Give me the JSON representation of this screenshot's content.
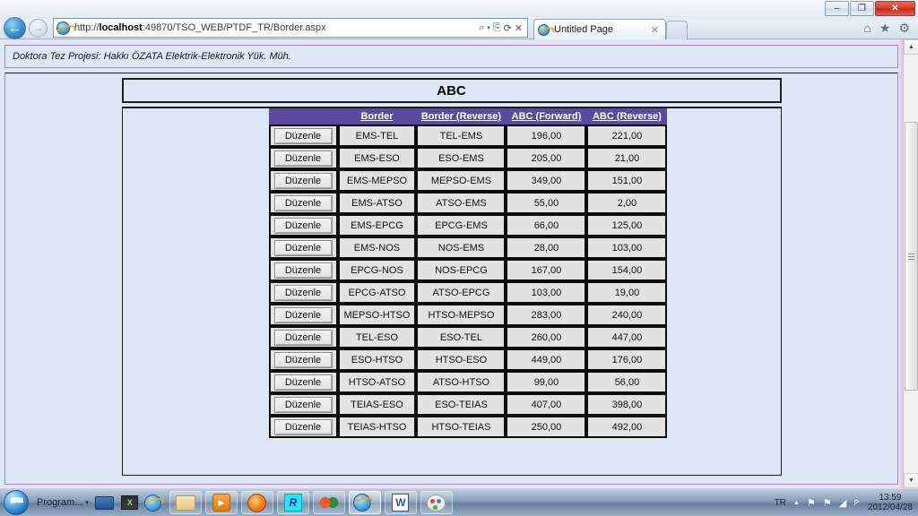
{
  "browser": {
    "window_controls": {
      "minimize": "–",
      "restore": "❐",
      "close": "✕"
    },
    "back_label": "←",
    "forward_label": "→",
    "url": "http://localhost:49870/TSO_WEB/PTDF_TR/Border.aspx",
    "url_host": "localhost",
    "url_prefix": "http://",
    "url_suffix": ":49870/TSO_WEB/PTDF_TR/Border.aspx",
    "address_icons": [
      "search-icon",
      "dropdown-caret",
      "compatibility-view-icon",
      "refresh-icon",
      "stop-icon"
    ],
    "search_glyph": "⌕",
    "caret_glyph": "▾",
    "compat_glyph": "⎘",
    "refresh_glyph": "⟳",
    "stop_glyph": "✕",
    "tab_title": "Untitled Page",
    "tab_close_glyph": "✕",
    "toolbar_icons": [
      {
        "name": "home-icon",
        "glyph": "⌂"
      },
      {
        "name": "favorites-icon",
        "glyph": "★"
      },
      {
        "name": "tools-gear-icon",
        "glyph": "⚙"
      }
    ]
  },
  "page": {
    "banner_text": "Doktora Tez Projesi: Hakkı ÖZATA Elektrik-Elektronik Yük. Müh.",
    "title": "ABC",
    "colors": {
      "page_background": "#dde7f5",
      "header_purple": "#5a4a9f",
      "cell_gray": "#e2e2e2",
      "frame_magenta": "#b77fc4"
    }
  },
  "grid": {
    "columns": [
      {
        "key": "command",
        "label": ""
      },
      {
        "key": "border",
        "label": "Border"
      },
      {
        "key": "border_reverse",
        "label": "Border (Reverse)"
      },
      {
        "key": "abc_forward",
        "label": "ABC (Forward)"
      },
      {
        "key": "abc_reverse",
        "label": "ABC (Reverse)"
      }
    ],
    "edit_label": "Düzenle",
    "rows": [
      {
        "border": "EMS-TEL",
        "border_reverse": "TEL-EMS",
        "abc_forward": "196,00",
        "abc_reverse": "221,00"
      },
      {
        "border": "EMS-ESO",
        "border_reverse": "ESO-EMS",
        "abc_forward": "205,00",
        "abc_reverse": "21,00"
      },
      {
        "border": "EMS-MEPSO",
        "border_reverse": "MEPSO-EMS",
        "abc_forward": "349,00",
        "abc_reverse": "151,00"
      },
      {
        "border": "EMS-ATSO",
        "border_reverse": "ATSO-EMS",
        "abc_forward": "55,00",
        "abc_reverse": "2,00"
      },
      {
        "border": "EMS-EPCG",
        "border_reverse": "EPCG-EMS",
        "abc_forward": "66,00",
        "abc_reverse": "125,00"
      },
      {
        "border": "EMS-NOS",
        "border_reverse": "NOS-EMS",
        "abc_forward": "28,00",
        "abc_reverse": "103,00"
      },
      {
        "border": "EPCG-NOS",
        "border_reverse": "NOS-EPCG",
        "abc_forward": "167,00",
        "abc_reverse": "154,00"
      },
      {
        "border": "EPCG-ATSO",
        "border_reverse": "ATSO-EPCG",
        "abc_forward": "103,00",
        "abc_reverse": "19,00"
      },
      {
        "border": "MEPSO-HTSO",
        "border_reverse": "HTSO-MEPSO",
        "abc_forward": "283,00",
        "abc_reverse": "240,00"
      },
      {
        "border": "TEL-ESO",
        "border_reverse": "ESO-TEL",
        "abc_forward": "260,00",
        "abc_reverse": "447,00"
      },
      {
        "border": "ESO-HTSO",
        "border_reverse": "HTSO-ESO",
        "abc_forward": "449,00",
        "abc_reverse": "176,00"
      },
      {
        "border": "HTSO-ATSO",
        "border_reverse": "ATSO-HTSO",
        "abc_forward": "99,00",
        "abc_reverse": "56,00"
      },
      {
        "border": "TEIAS-ESO",
        "border_reverse": "ESO-TEIAS",
        "abc_forward": "407,00",
        "abc_reverse": "398,00"
      },
      {
        "border": "TEIAS-HTSO",
        "border_reverse": "HTSO-TEIAS",
        "abc_forward": "250,00",
        "abc_reverse": "492,00"
      }
    ]
  },
  "scrollbar": {
    "up_glyph": "▲",
    "down_glyph": "▼"
  },
  "taskbar": {
    "start_label": "Start",
    "quicklaunch_label": "Program...",
    "quicklaunch_caret": "▾",
    "items": [
      {
        "name": "taskbar-icon-show-desktop"
      },
      {
        "name": "taskbar-icon-excel"
      },
      {
        "name": "taskbar-icon-internet-explorer"
      },
      {
        "name": "taskbar-button-explorer"
      },
      {
        "name": "taskbar-button-media-player"
      },
      {
        "name": "taskbar-button-firefox"
      },
      {
        "name": "taskbar-button-r-project"
      },
      {
        "name": "taskbar-button-rings-app"
      },
      {
        "name": "taskbar-button-internet-explorer"
      },
      {
        "name": "taskbar-button-word"
      },
      {
        "name": "taskbar-button-paint"
      }
    ],
    "tray": {
      "language": "TR",
      "show_hidden_glyph": "▲",
      "icons": [
        "flag-icon",
        "action-center-icon",
        "network-icon",
        "volume-icon"
      ],
      "flag_glyph": "⚑",
      "action_glyph": "⚑",
      "network_glyph": "◢",
      "volume_glyph": "ᴘ",
      "time": "13:59",
      "date": "2012/04/28"
    }
  }
}
